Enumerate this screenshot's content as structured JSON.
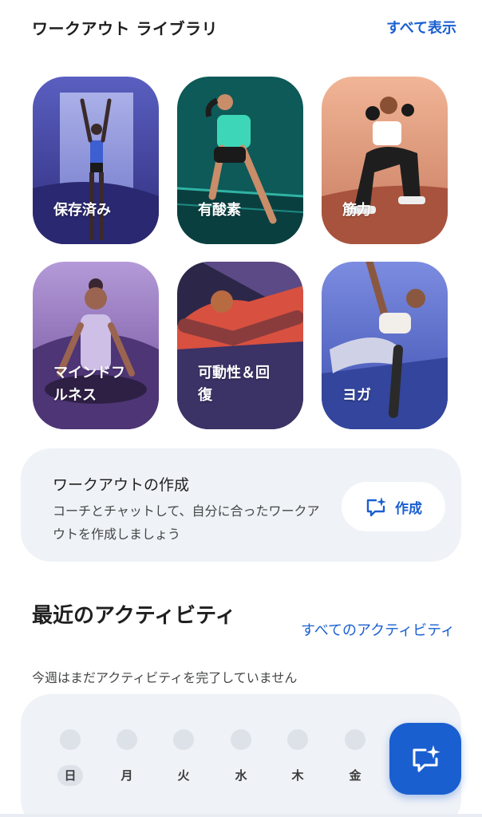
{
  "library": {
    "title": "ワークアウト ライブラリ",
    "see_all": "すべて表示",
    "categories": [
      {
        "label": "保存済み"
      },
      {
        "label": "有酸素"
      },
      {
        "label": "筋力"
      },
      {
        "label": "マインドフ\nルネス"
      },
      {
        "label": "可動性＆回\n復"
      },
      {
        "label": "ヨガ"
      }
    ]
  },
  "create": {
    "title": "ワークアウトの作成",
    "description": "コーチとチャットして、自分に合ったワークアウトを作成しましょう",
    "button_label": "作成"
  },
  "activity": {
    "title": "最近のアクティビティ",
    "see_all": "すべてのアクティビティ",
    "subtitle": "今週はまだアクティビティを完了していません",
    "days": [
      "日",
      "月",
      "火",
      "水",
      "木",
      "金"
    ]
  },
  "icons": {
    "create": "chat-sparkle-icon",
    "fab": "chat-sparkle-icon"
  },
  "colors": {
    "accent": "#1a5fd0",
    "card_background": "#eff2f7",
    "day_dot": "#dde2e9"
  }
}
